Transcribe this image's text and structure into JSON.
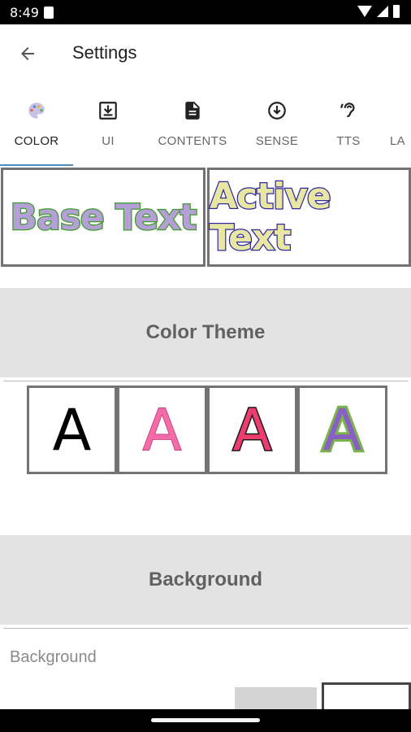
{
  "status_bar": {
    "time": "8:49"
  },
  "app_bar": {
    "title": "Settings",
    "back_icon": "arrow-back-icon"
  },
  "tabs": [
    {
      "label": "COLOR",
      "icon": "palette-icon",
      "active": true
    },
    {
      "label": "UI",
      "icon": "download-box-icon",
      "active": false
    },
    {
      "label": "CONTENTS",
      "icon": "document-icon",
      "active": false
    },
    {
      "label": "SENSE",
      "icon": "arrow-circle-down-icon",
      "active": false
    },
    {
      "label": "TTS",
      "icon": "hearing-icon",
      "active": false
    },
    {
      "label": "LA",
      "icon": "",
      "active": false
    }
  ],
  "preview": {
    "base_text": "Base Text",
    "active_text": "Active Text"
  },
  "sections": {
    "color_theme": "Color Theme",
    "background": "Background"
  },
  "color_themes": [
    {
      "letter": "A",
      "style": "plain-black"
    },
    {
      "letter": "A",
      "style": "pink-outline"
    },
    {
      "letter": "A",
      "style": "red-black-outline"
    },
    {
      "letter": "A",
      "style": "purple-green-outline"
    }
  ],
  "background_setting": {
    "label": "Background"
  },
  "colors": {
    "base_text_fill": "#b49fd6",
    "base_text_stroke": "#3e9a2c",
    "active_text_fill": "#e8e6a2",
    "active_text_stroke": "#2e2a9b",
    "tab_indicator": "#4a8fbf",
    "section_bg": "#e3e3e3"
  }
}
